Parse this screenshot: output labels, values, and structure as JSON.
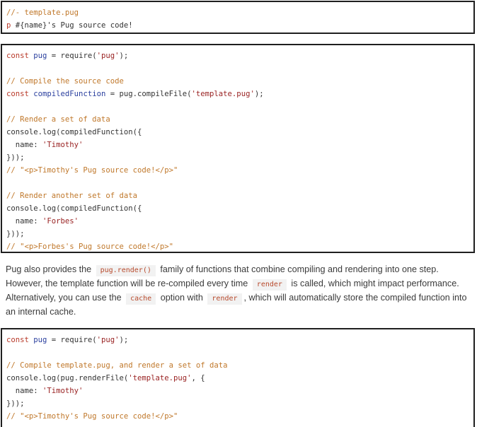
{
  "code_blocks": [
    {
      "lines": [
        [
          {
            "t": "cm",
            "v": "//- template.pug"
          }
        ],
        [
          {
            "t": "kw",
            "v": "p"
          },
          {
            "t": "id",
            "v": " #{name}'s Pug source code!"
          }
        ]
      ]
    },
    {
      "lines": [
        [
          {
            "t": "kw",
            "v": "const"
          },
          {
            "t": "id",
            "v": " "
          },
          {
            "t": "fn",
            "v": "pug"
          },
          {
            "t": "id",
            "v": " = require("
          },
          {
            "t": "str",
            "v": "'pug'"
          },
          {
            "t": "id",
            "v": ");"
          }
        ],
        [],
        [
          {
            "t": "cm",
            "v": "// Compile the source code"
          }
        ],
        [
          {
            "t": "kw",
            "v": "const"
          },
          {
            "t": "id",
            "v": " "
          },
          {
            "t": "fn",
            "v": "compiledFunction"
          },
          {
            "t": "id",
            "v": " = pug.compileFile("
          },
          {
            "t": "str",
            "v": "'template.pug'"
          },
          {
            "t": "id",
            "v": ");"
          }
        ],
        [],
        [
          {
            "t": "cm",
            "v": "// Render a set of data"
          }
        ],
        [
          {
            "t": "id",
            "v": "console.log(compiledFunction({"
          }
        ],
        [
          {
            "t": "id",
            "v": "  name: "
          },
          {
            "t": "str",
            "v": "'Timothy'"
          }
        ],
        [
          {
            "t": "id",
            "v": "}));"
          }
        ],
        [
          {
            "t": "cm",
            "v": "// \"<p>Timothy's Pug source code!</p>\""
          }
        ],
        [],
        [
          {
            "t": "cm",
            "v": "// Render another set of data"
          }
        ],
        [
          {
            "t": "id",
            "v": "console.log(compiledFunction({"
          }
        ],
        [
          {
            "t": "id",
            "v": "  name: "
          },
          {
            "t": "str",
            "v": "'Forbes'"
          }
        ],
        [
          {
            "t": "id",
            "v": "}));"
          }
        ],
        [
          {
            "t": "cm",
            "v": "// \"<p>Forbes's Pug source code!</p>\""
          }
        ]
      ]
    },
    {
      "lines": [
        [
          {
            "t": "kw",
            "v": "const"
          },
          {
            "t": "id",
            "v": " "
          },
          {
            "t": "fn",
            "v": "pug"
          },
          {
            "t": "id",
            "v": " = require("
          },
          {
            "t": "str",
            "v": "'pug'"
          },
          {
            "t": "id",
            "v": ");"
          }
        ],
        [],
        [
          {
            "t": "cm",
            "v": "// Compile template.pug, and render a set of data"
          }
        ],
        [
          {
            "t": "id",
            "v": "console.log(pug.renderFile("
          },
          {
            "t": "str",
            "v": "'template.pug'"
          },
          {
            "t": "id",
            "v": ", {"
          }
        ],
        [
          {
            "t": "id",
            "v": "  name: "
          },
          {
            "t": "str",
            "v": "'Timothy'"
          }
        ],
        [
          {
            "t": "id",
            "v": "}));"
          }
        ],
        [
          {
            "t": "cm",
            "v": "// \"<p>Timothy's Pug source code!</p>\""
          }
        ]
      ]
    }
  ],
  "prose": {
    "line1": {
      "a": "Pug also provides the",
      "code1": "pug.render()",
      "b": "family of functions that combine compiling and rendering into one step."
    },
    "line2": {
      "a": "However, the template function will be re-compiled every time",
      "code1": "render",
      "b": "is called, which might impact performance."
    },
    "line3": {
      "a": "Alternatively, you can use the",
      "code1": "cache",
      "b": "option with",
      "code2": "render",
      ",c": "",
      "c": ", which will automatically store the compiled function into"
    },
    "line4": {
      "a": "an internal cache."
    }
  }
}
